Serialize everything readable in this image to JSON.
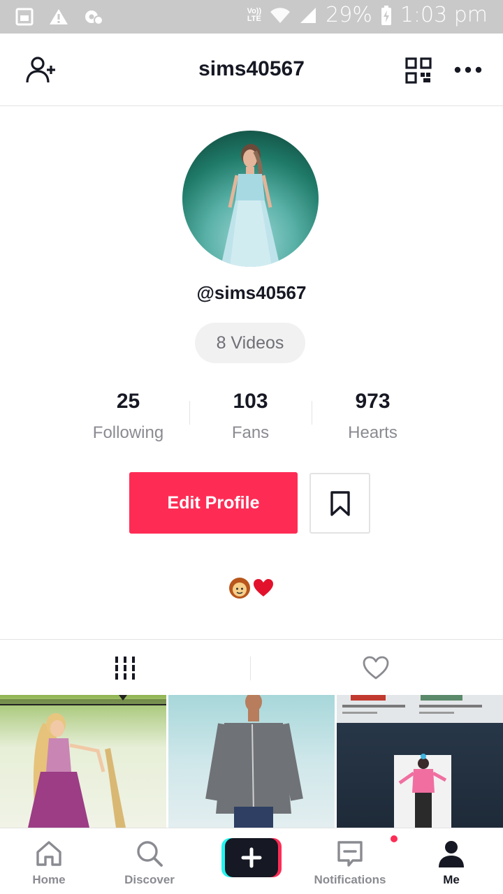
{
  "status_bar": {
    "volte_line1": "Vo))",
    "volte_line2": "LTE",
    "battery_text": "29%",
    "time": "1:03 pm"
  },
  "header": {
    "username": "sims40567"
  },
  "profile": {
    "handle": "@sims40567",
    "videos_label": "8 Videos",
    "stats": [
      {
        "value": "25",
        "label": "Following"
      },
      {
        "value": "103",
        "label": "Fans"
      },
      {
        "value": "973",
        "label": "Hearts"
      }
    ],
    "edit_button": "Edit Profile",
    "bio_emojis": "👩❤"
  },
  "tabs": {
    "videos_icon": "grid-icon",
    "liked_icon": "heart-icon"
  },
  "bottom_nav": {
    "items": [
      {
        "label": "Home",
        "icon": "home-icon"
      },
      {
        "label": "Discover",
        "icon": "search-icon"
      },
      {
        "label": "",
        "icon": "plus-icon"
      },
      {
        "label": "Notifications",
        "icon": "inbox-icon"
      },
      {
        "label": "Me",
        "icon": "profile-icon"
      }
    ]
  },
  "colors": {
    "accent": "#fe2c55",
    "text": "#161823",
    "muted": "#8a8b91"
  }
}
